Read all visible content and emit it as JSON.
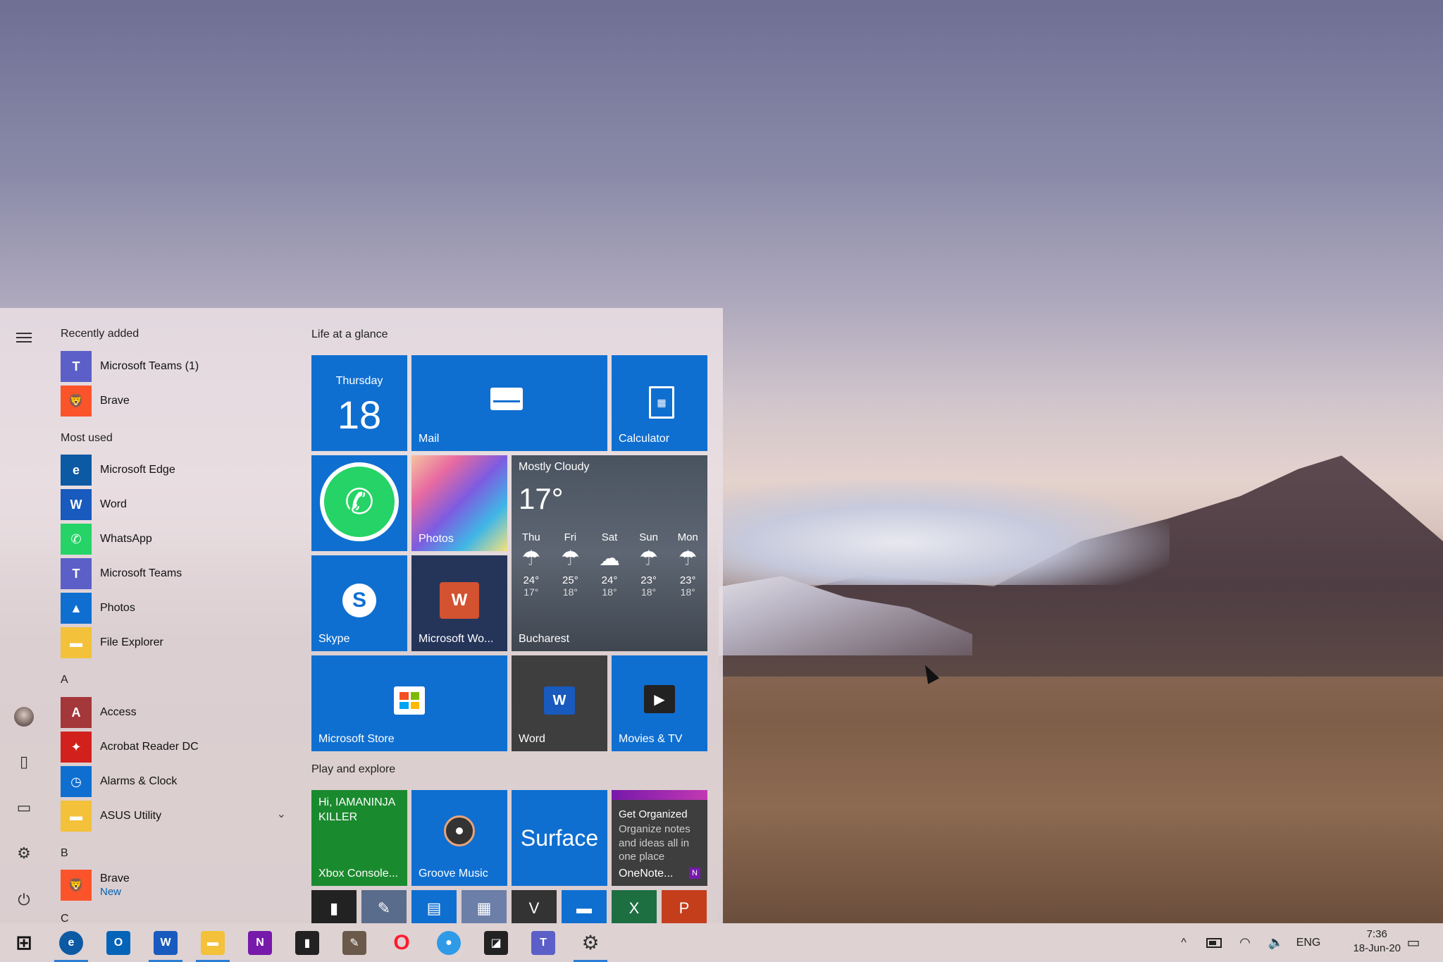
{
  "start_menu": {
    "app_list": {
      "recently_added_title": "Recently added",
      "recently_added": [
        {
          "label": "Microsoft Teams (1)",
          "icon": "teams-icon",
          "color": "#5b5fc7",
          "glyph": "T"
        },
        {
          "label": "Brave",
          "icon": "brave-icon",
          "color": "#fb542b",
          "glyph": "🦁"
        }
      ],
      "most_used_title": "Most used",
      "most_used": [
        {
          "label": "Microsoft Edge",
          "icon": "edge-icon",
          "color": "#0c59a4",
          "glyph": "e"
        },
        {
          "label": "Word",
          "icon": "word-icon",
          "color": "#185abd",
          "glyph": "W"
        },
        {
          "label": "WhatsApp",
          "icon": "whatsapp-icon",
          "color": "#25d366",
          "glyph": "✆"
        },
        {
          "label": "Microsoft Teams",
          "icon": "teams-icon",
          "color": "#5b5fc7",
          "glyph": "T"
        },
        {
          "label": "Photos",
          "icon": "photos-icon",
          "color": "#0f6fd1",
          "glyph": "▲"
        },
        {
          "label": "File Explorer",
          "icon": "folder-icon",
          "color": "#f3c13a",
          "glyph": "▬"
        }
      ],
      "letter_a": "A",
      "a_apps": [
        {
          "label": "Access",
          "icon": "access-icon",
          "color": "#a4373a",
          "glyph": "A"
        },
        {
          "label": "Acrobat Reader DC",
          "icon": "acrobat-icon",
          "color": "#d2201d",
          "glyph": "✦"
        },
        {
          "label": "Alarms & Clock",
          "icon": "clock-icon",
          "color": "#0f6fd1",
          "glyph": "◷"
        },
        {
          "label": "ASUS Utility",
          "icon": "folder-icon",
          "color": "#f3c13a",
          "glyph": "▬"
        }
      ],
      "letter_b": "B",
      "b_apps": [
        {
          "label": "Brave",
          "sublabel": "New",
          "icon": "brave-icon",
          "color": "#fb542b",
          "glyph": "🦁"
        }
      ],
      "letter_c": "C"
    },
    "tiles": {
      "group1_title": "Life at a glance",
      "calendar": {
        "day": "Thursday",
        "date": "18"
      },
      "mail": "Mail",
      "calculator": "Calculator",
      "photos": "Photos",
      "weather": {
        "condition": "Mostly Cloudy",
        "temp": "17°",
        "city": "Bucharest",
        "days": [
          {
            "day": "Thu",
            "hi": "24°",
            "lo": "17°",
            "icon": "☂"
          },
          {
            "day": "Fri",
            "hi": "25°",
            "lo": "18°",
            "icon": "☂"
          },
          {
            "day": "Sat",
            "hi": "24°",
            "lo": "18°",
            "icon": "☁"
          },
          {
            "day": "Sun",
            "hi": "23°",
            "lo": "18°",
            "icon": "☂"
          },
          {
            "day": "Mon",
            "hi": "23°",
            "lo": "18°",
            "icon": "☂"
          }
        ]
      },
      "skype": "Skype",
      "office": "Microsoft Wo...",
      "store": "Microsoft Store",
      "word": "Word",
      "movies": "Movies & TV",
      "group2_title": "Play and explore",
      "xbox": {
        "greeting": "Hi, IAMANINJAKILLER",
        "label": "Xbox Console..."
      },
      "groove": "Groove Music",
      "surface": "Surface",
      "onenote": {
        "title": "Get Organized",
        "body": "Organize notes and ideas all in one place",
        "label": "OneNote..."
      },
      "small_tiles": [
        {
          "icon": "deezer-icon",
          "color": "#222222",
          "glyph": "▮"
        },
        {
          "icon": "paint-icon",
          "color": "#5a6c8c",
          "glyph": "✎"
        },
        {
          "icon": "notepad-icon",
          "color": "#0f6fd1",
          "glyph": "▤"
        },
        {
          "icon": "tiles-icon",
          "color": "#6b7fa8",
          "glyph": "▦"
        },
        {
          "icon": "vivaldi-icon",
          "color": "#333333",
          "glyph": "V"
        },
        {
          "icon": "folder-icon",
          "color": "#0f6fd1",
          "glyph": "▬"
        },
        {
          "icon": "excel-icon",
          "color": "#1d6f42",
          "glyph": "X"
        },
        {
          "icon": "powerpoint-icon",
          "color": "#c43e1c",
          "glyph": "P"
        }
      ]
    }
  },
  "taskbar": {
    "apps": [
      {
        "icon": "windows-start-icon",
        "color": "#0078d7",
        "glyph": "⊞",
        "active": false
      },
      {
        "icon": "edge-icon",
        "color": "#0c59a4",
        "glyph": "e",
        "active": true
      },
      {
        "icon": "outlook-icon",
        "color": "#0364b8",
        "glyph": "O",
        "active": false
      },
      {
        "icon": "word-icon",
        "color": "#185abd",
        "glyph": "W",
        "active": true
      },
      {
        "icon": "folder-icon",
        "color": "#f3c13a",
        "glyph": "▬",
        "active": true
      },
      {
        "icon": "onenote-icon",
        "color": "#7719aa",
        "glyph": "N",
        "active": false
      },
      {
        "icon": "deezer-icon",
        "color": "#222222",
        "glyph": "▮",
        "active": false
      },
      {
        "icon": "gimp-icon",
        "color": "#6b5a4a",
        "glyph": "✎",
        "active": false
      },
      {
        "icon": "opera-icon",
        "color": "#ff1b2d",
        "glyph": "O",
        "active": false
      },
      {
        "icon": "browser-icon",
        "color": "#2f9be8",
        "glyph": "●",
        "active": false
      },
      {
        "icon": "sticky-notes-icon",
        "color": "#222222",
        "glyph": "◪",
        "active": false
      },
      {
        "icon": "teams-icon",
        "color": "#5b5fc7",
        "glyph": "T",
        "active": false
      },
      {
        "icon": "settings-icon",
        "color": "#555555",
        "glyph": "⚙",
        "active": true
      }
    ],
    "tray": {
      "chevron": "^",
      "lang": "ENG",
      "time": "7:36",
      "date": "18-Jun-20"
    }
  }
}
